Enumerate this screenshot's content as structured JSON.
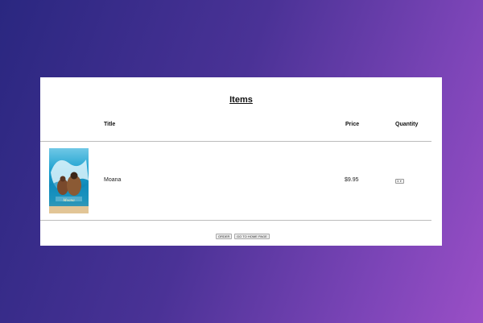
{
  "page": {
    "heading": "Items"
  },
  "table": {
    "columns": [
      "",
      "Title",
      "Price",
      "Quantity"
    ],
    "rows": [
      {
        "poster": "moana-poster-image",
        "title": "Moana",
        "price": "$9.95",
        "quantity": "1"
      }
    ]
  },
  "actions": {
    "order_label": "ORDER",
    "home_label": "GO TO HOME PAGE"
  },
  "icons": {
    "select_arrow": "chevron-down-icon"
  }
}
